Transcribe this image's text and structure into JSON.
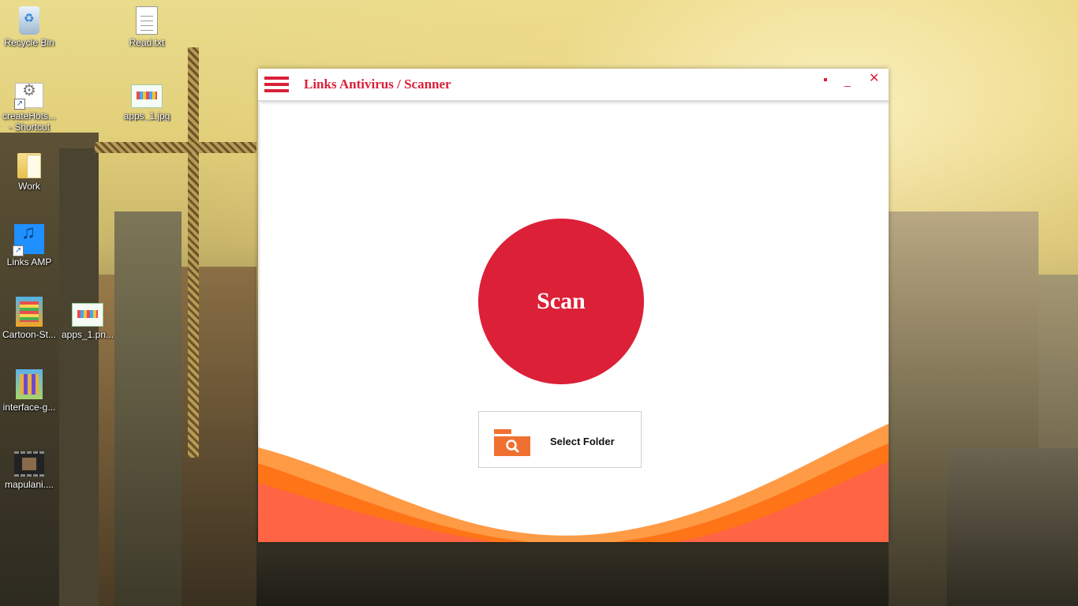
{
  "desktop": {
    "icons": [
      {
        "label": "Recycle Bin",
        "icon": "recycle-bin-icon"
      },
      {
        "label": "Read.txt",
        "icon": "text-file-icon"
      },
      {
        "label": "createHots...",
        "label2": "- Shortcut",
        "icon": "shortcut-app-icon"
      },
      {
        "label": "apps_1.jpg",
        "icon": "image-file-icon"
      },
      {
        "label": "Work",
        "icon": "folder-icon"
      },
      {
        "label": "Links AMP",
        "icon": "music-app-icon"
      },
      {
        "label": "Cartoon-St...",
        "icon": "image-file-icon"
      },
      {
        "label": "apps_1.pn...",
        "icon": "image-file-icon"
      },
      {
        "label": "interface-g...",
        "icon": "image-file-icon"
      },
      {
        "label": "mapulani....",
        "icon": "video-file-icon"
      }
    ]
  },
  "app": {
    "title": "Links Antivirus / Scanner",
    "controls": {
      "minimize": "_",
      "close": "✕"
    },
    "scan_label": "Scan",
    "select_folder_label": "Select Folder",
    "colors": {
      "accent": "#dc2038",
      "wave_light": "#ff9a45",
      "wave_mid": "#ff7417",
      "wave_base": "#ff6444",
      "folder_icon": "#f07032"
    }
  }
}
